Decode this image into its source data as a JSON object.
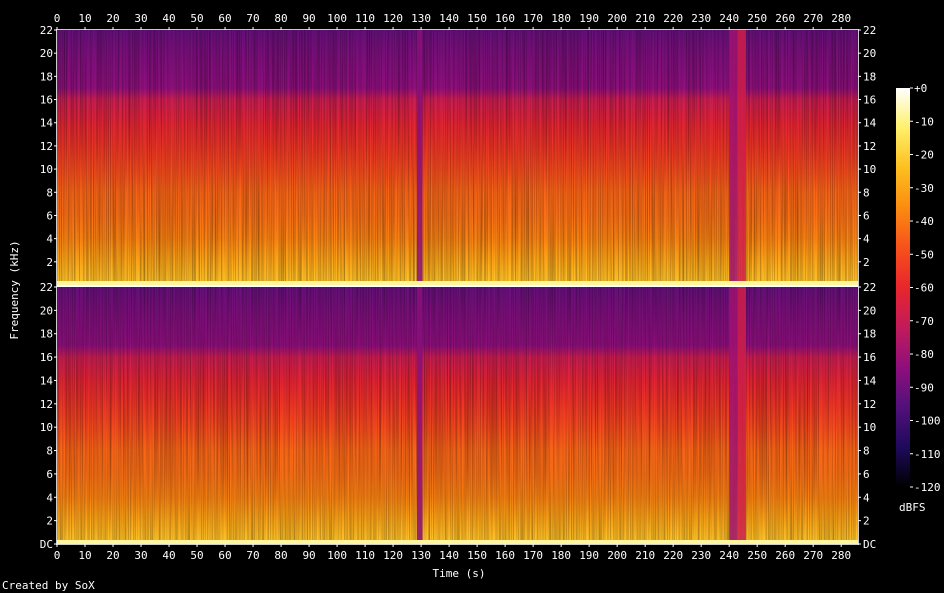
{
  "chart_data": {
    "type": "heatmap",
    "title": "",
    "xlabel": "Time (s)",
    "ylabel": "Frequency (kHz)",
    "credit": "Created by SoX",
    "xlim": [
      0,
      286
    ],
    "x_ticks": [
      "0",
      "10",
      "20",
      "30",
      "40",
      "50",
      "60",
      "70",
      "80",
      "90",
      "100",
      "110",
      "120",
      "130",
      "140",
      "150",
      "160",
      "170",
      "180",
      "190",
      "200",
      "210",
      "220",
      "230",
      "240",
      "250",
      "260",
      "270",
      "280"
    ],
    "ylim": [
      0,
      22
    ],
    "y_ticks": [
      "DC",
      "2",
      "4",
      "6",
      "8",
      "10",
      "12",
      "14",
      "16",
      "18",
      "20",
      "22"
    ],
    "channels": 2,
    "colorbar": {
      "label": "dBFS",
      "range": [
        -120,
        0
      ],
      "ticks": [
        "+0",
        "-10",
        "-20",
        "-30",
        "-40",
        "-50",
        "-60",
        "-70",
        "-80",
        "-90",
        "-100",
        "-110",
        "-120"
      ],
      "colors": [
        "#000000",
        "#1e0a5c",
        "#52107a",
        "#8e0f7c",
        "#c21b5a",
        "#e8262c",
        "#f7511b",
        "#fb8c10",
        "#fdbf1f",
        "#fff06a",
        "#ffffff"
      ]
    },
    "spectral_level_by_frequency": [
      {
        "khz": 0,
        "dbfs": -22
      },
      {
        "khz": 2,
        "dbfs": -30
      },
      {
        "khz": 4,
        "dbfs": -38
      },
      {
        "khz": 6,
        "dbfs": -42
      },
      {
        "khz": 8,
        "dbfs": -44
      },
      {
        "khz": 10,
        "dbfs": -50
      },
      {
        "khz": 12,
        "dbfs": -56
      },
      {
        "khz": 14,
        "dbfs": -62
      },
      {
        "khz": 16,
        "dbfs": -70
      },
      {
        "khz": 17,
        "dbfs": -84
      },
      {
        "khz": 20,
        "dbfs": -88
      },
      {
        "khz": 22,
        "dbfs": -92
      }
    ],
    "quiet_segments_s": [
      {
        "start": 128.5,
        "end": 130.5,
        "dbfs": -85
      },
      {
        "start": 240,
        "end": 243,
        "dbfs": -80
      },
      {
        "start": 243,
        "end": 246,
        "dbfs": -68
      }
    ]
  }
}
